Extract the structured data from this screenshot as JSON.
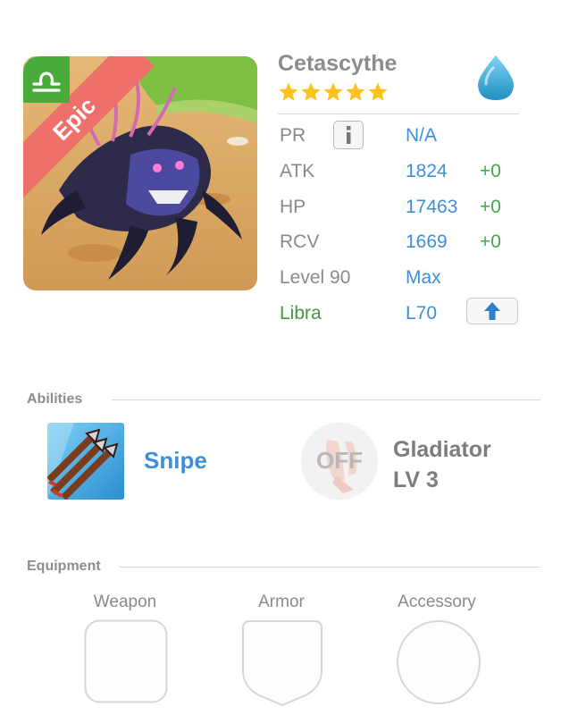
{
  "monster": {
    "name": "Cetascythe",
    "rarity": "Epic",
    "stars": 5,
    "element_icon": "water-drop-icon",
    "zodiac_icon": "libra-icon"
  },
  "stats": {
    "pr": {
      "label": "PR",
      "value": "N/A"
    },
    "atk": {
      "label": "ATK",
      "value": "1824",
      "bonus": "+0"
    },
    "hp": {
      "label": "HP",
      "value": "17463",
      "bonus": "+0"
    },
    "rcv": {
      "label": "RCV",
      "value": "1669",
      "bonus": "+0"
    },
    "level": {
      "label": "Level 90",
      "value": "Max"
    },
    "zodiac": {
      "label": "Libra",
      "value": "L70"
    }
  },
  "abilities": {
    "title": "Abilities",
    "active": {
      "name": "Snipe",
      "icon": "arrows-icon"
    },
    "passive": {
      "state": "OFF",
      "name_line1": "Gladiator",
      "name_line2": "LV 3",
      "icon": "claw-icon"
    }
  },
  "equipment": {
    "title": "Equipment",
    "slots": [
      {
        "label": "Weapon",
        "shape": "rounded-square"
      },
      {
        "label": "Armor",
        "shape": "shield"
      },
      {
        "label": "Accessory",
        "shape": "circle"
      }
    ]
  },
  "colors": {
    "accent_blue": "#3d8fd9",
    "bonus_green": "#3fa84b",
    "epic_red": "#ef6f6b"
  }
}
